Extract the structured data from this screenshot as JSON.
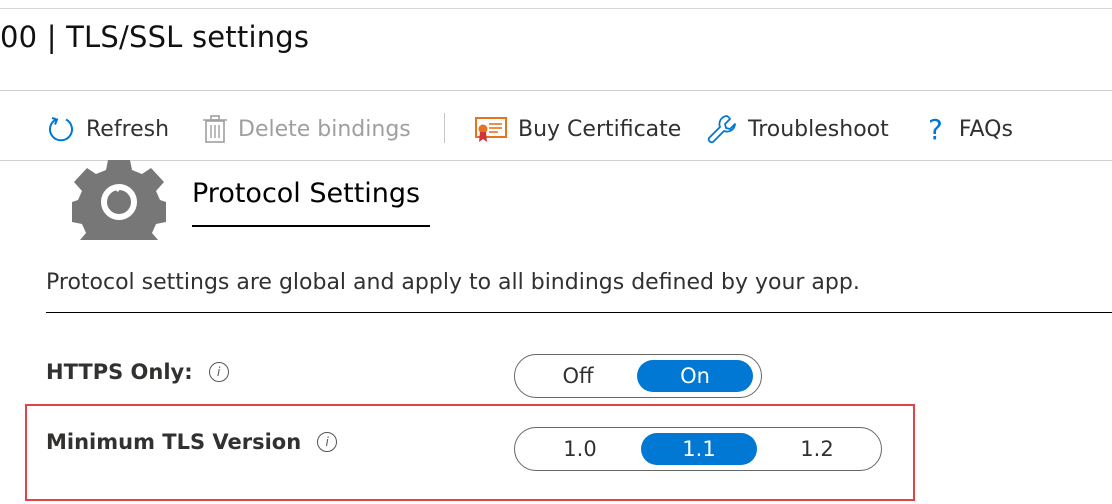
{
  "header": {
    "title": "00 | TLS/SSL settings"
  },
  "toolbar": {
    "refresh_label": "Refresh",
    "delete_label": "Delete bindings",
    "buy_label": "Buy Certificate",
    "troubleshoot_label": "Troubleshoot",
    "faqs_label": "FAQs"
  },
  "section": {
    "title": "Protocol Settings",
    "description": "Protocol settings are global and apply to all bindings defined by your app."
  },
  "settings": {
    "https_only": {
      "label": "HTTPS Only:",
      "info_glyph": "i",
      "options": [
        "Off",
        "On"
      ],
      "selected": "On"
    },
    "min_tls": {
      "label": "Minimum TLS Version",
      "info_glyph": "i",
      "options": [
        "1.0",
        "1.1",
        "1.2"
      ],
      "selected": "1.1"
    }
  },
  "icons": {
    "refresh": "refresh-icon",
    "delete": "trash-icon",
    "buy": "certificate-icon",
    "troubleshoot": "wrench-icon",
    "faqs": "question-icon",
    "section": "gear-icon"
  },
  "colors": {
    "accent": "#0078d4",
    "highlight_border": "#e04348",
    "cert_icon": "#e8731c"
  }
}
